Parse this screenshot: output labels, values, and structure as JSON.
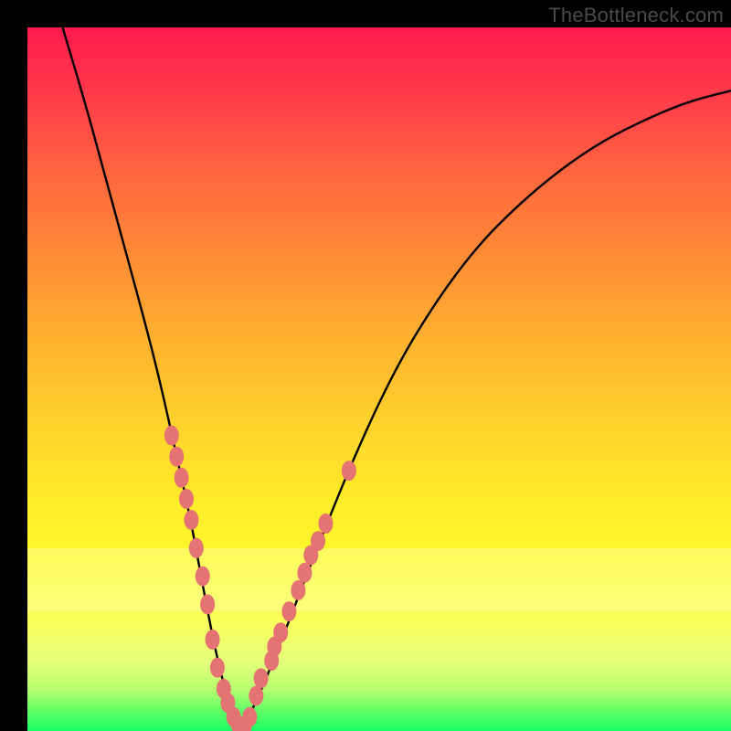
{
  "watermark": "TheBottleneck.com",
  "colors": {
    "frame": "#000000",
    "curve": "#000000",
    "marker_fill": "#e57373",
    "marker_stroke": "#d46a6a",
    "gradient_top": "#ff1a4d",
    "gradient_bottom": "#1aff66"
  },
  "chart_data": {
    "type": "line",
    "title": "",
    "xlabel": "",
    "ylabel": "",
    "xlim": [
      0,
      100
    ],
    "ylim": [
      0,
      100
    ],
    "grid": false,
    "legend": false,
    "annotations": [],
    "series": [
      {
        "name": "curve",
        "x": [
          5,
          8,
          11,
          14,
          17,
          19,
          21,
          23,
          24.5,
          26,
          27.5,
          29,
          30.5,
          32,
          35,
          40,
          46,
          52,
          58,
          64,
          70,
          76,
          82,
          88,
          94,
          100
        ],
        "y": [
          100,
          90,
          79,
          68,
          57,
          49,
          40,
          31,
          23,
          15,
          8,
          3,
          0.5,
          3,
          10,
          23,
          38,
          51,
          61,
          69,
          75,
          80,
          84,
          87,
          89.5,
          91
        ]
      }
    ],
    "markers": [
      {
        "x": 20.5,
        "y": 42
      },
      {
        "x": 21.2,
        "y": 39
      },
      {
        "x": 21.9,
        "y": 36
      },
      {
        "x": 22.6,
        "y": 33
      },
      {
        "x": 23.3,
        "y": 30
      },
      {
        "x": 24.0,
        "y": 26
      },
      {
        "x": 24.9,
        "y": 22
      },
      {
        "x": 25.6,
        "y": 18
      },
      {
        "x": 26.3,
        "y": 13
      },
      {
        "x": 27.0,
        "y": 9
      },
      {
        "x": 27.9,
        "y": 6
      },
      {
        "x": 28.5,
        "y": 4
      },
      {
        "x": 29.3,
        "y": 2
      },
      {
        "x": 30.0,
        "y": 0.8
      },
      {
        "x": 30.8,
        "y": 0.5
      },
      {
        "x": 31.6,
        "y": 2
      },
      {
        "x": 32.5,
        "y": 5
      },
      {
        "x": 33.2,
        "y": 7.5
      },
      {
        "x": 34.7,
        "y": 10
      },
      {
        "x": 35.1,
        "y": 12
      },
      {
        "x": 36.0,
        "y": 14
      },
      {
        "x": 37.2,
        "y": 17
      },
      {
        "x": 38.5,
        "y": 20
      },
      {
        "x": 39.4,
        "y": 22.5
      },
      {
        "x": 40.3,
        "y": 25
      },
      {
        "x": 41.3,
        "y": 27
      },
      {
        "x": 42.4,
        "y": 29.5
      },
      {
        "x": 45.7,
        "y": 37
      }
    ]
  }
}
